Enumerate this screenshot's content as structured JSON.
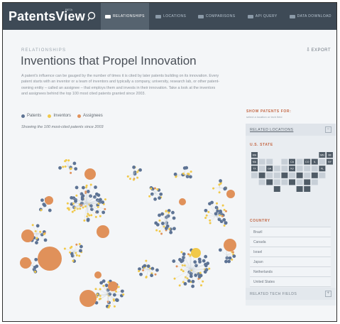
{
  "header": {
    "logo_text": "PatentsView",
    "logo_tag": "BETA",
    "tabs": [
      {
        "label": "RELATIONSHIPS",
        "icon": "relationship-icon",
        "active": true
      },
      {
        "label": "LOCATIONS",
        "icon": "locations-icon",
        "active": false
      },
      {
        "label": "COMPARISONS",
        "icon": "comparison-icon",
        "active": false
      },
      {
        "label": "API QUERY",
        "icon": "query-icon",
        "active": false
      },
      {
        "label": "DATA DOWNLOAD",
        "icon": "download-icon",
        "active": false
      }
    ]
  },
  "main": {
    "section_label": "RELATIONSHIPS",
    "title": "Inventions that Propel Innovation",
    "export_label": "EXPORT",
    "intro": "A patent's influence can be gauged by the number of times it is cited by later patents building on its innovation. Every patent starts with an inventor or a team of inventors and typically a company, university, research lab, or other patent-owning entity – called an assignee – that employs them and invests in their innovation. Take a look at the inventors and assignees behind the top 100 most cited patents granted since 2003.",
    "legend": [
      {
        "label": "Patents",
        "color": "#5d7394"
      },
      {
        "label": "Inventors",
        "color": "#f1c94a"
      },
      {
        "label": "Assignees",
        "color": "#e0915a"
      }
    ],
    "showing": "Showing the 100 most-cited patents since 2003"
  },
  "filters": {
    "show_label": "SHOW PATENTS FOR:",
    "show_sub": "select a location or tech field",
    "related_locations": "RELATED LOCATIONS",
    "state_title": "U.S. STATE",
    "states": [
      {
        "abbr": "WA",
        "on": true
      },
      {
        "abbr": "MN",
        "on": true
      },
      {
        "abbr": "MI",
        "on": true
      },
      {
        "abbr": "MA",
        "on": true
      },
      {
        "abbr": "CA",
        "on": true
      },
      {
        "abbr": "CO",
        "on": true
      },
      {
        "abbr": "IL",
        "on": true
      },
      {
        "abbr": "NY",
        "on": true
      },
      {
        "abbr": "TX",
        "on": true
      },
      {
        "abbr": "GA",
        "on": true
      },
      {
        "abbr": "NJ",
        "on": true
      },
      {
        "abbr": "FL",
        "on": true
      }
    ],
    "country_title": "COUNTRY",
    "countries": [
      "Brazil",
      "Canada",
      "Israel",
      "Japan",
      "Netherlands",
      "United States"
    ],
    "related_tech": "RELATED TECH FIELDS"
  },
  "colors": {
    "patent": "#5d7394",
    "inventor": "#f1c94a",
    "assignee": "#e0915a",
    "header": "#3e4a56",
    "accent": "#c46744"
  }
}
